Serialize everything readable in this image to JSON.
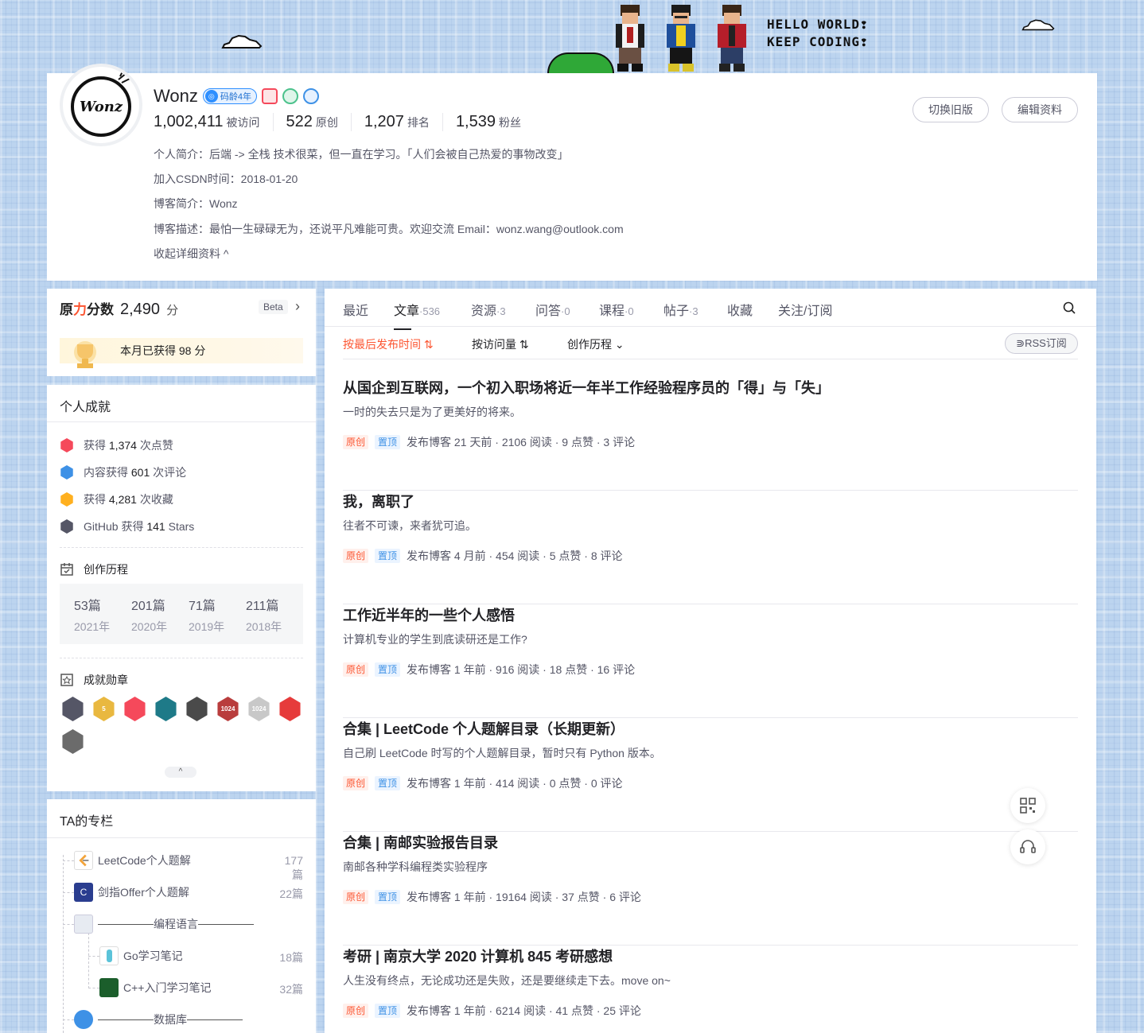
{
  "banner": {
    "hello_line1": "HELLO WORLD❢",
    "hello_line2": "KEEP CODING❢"
  },
  "profile": {
    "avatar_text": "Wonz",
    "username": "Wonz",
    "code_age_badge": "码龄4年",
    "stats": [
      {
        "value": "1,002,411",
        "label": "被访问"
      },
      {
        "value": "522",
        "label": "原创"
      },
      {
        "value": "1,207",
        "label": "排名"
      },
      {
        "value": "1,539",
        "label": "粉丝"
      }
    ],
    "intro": "个人简介：后端 -> 全栈 技术很菜，但一直在学习。「人们会被自己热爱的事物改变」",
    "join_date": "加入CSDN时间：2018-01-20",
    "blog_name": "博客简介：Wonz",
    "blog_desc": "博客描述：最怕一生碌碌无为，还说平凡难能可贵。欢迎交流 Email：wonz.wang@outlook.com",
    "collapse_label": "收起详细资料 ^",
    "switch_old_label": "切换旧版",
    "edit_label": "编辑资料"
  },
  "score": {
    "title_prefix": "原",
    "title_accent": "力",
    "title_suffix": "分数",
    "value": "2,490",
    "unit": "分",
    "beta": "Beta",
    "chevron": "›",
    "month_text": "本月已获得 98 分"
  },
  "achievements": {
    "title": "个人成就",
    "items": [
      {
        "pre": "获得 ",
        "num": "1,374",
        "post": " 次点赞",
        "color": "#f5495b"
      },
      {
        "pre": "内容获得 ",
        "num": "601",
        "post": " 次评论",
        "color": "#3e91e6"
      },
      {
        "pre": "获得 ",
        "num": "4,281",
        "post": " 次收藏",
        "color": "#ffb01f"
      },
      {
        "pre": "GitHub 获得 ",
        "num": "141",
        "post": " Stars",
        "color": "#555666"
      }
    ],
    "history_title": "创作历程",
    "history": [
      {
        "count": "53篇",
        "year": "2021年"
      },
      {
        "count": "201篇",
        "year": "2020年"
      },
      {
        "count": "71篇",
        "year": "2019年"
      },
      {
        "count": "211篇",
        "year": "2018年"
      }
    ],
    "medals_title": "成就勋章",
    "medals": [
      {
        "icon": "github-medal",
        "color": "#555666",
        "text": ""
      },
      {
        "icon": "5-year-medal",
        "color": "#e9b840",
        "text": "5"
      },
      {
        "icon": "red-star-medal",
        "color": "#f5495b",
        "text": ""
      },
      {
        "icon": "list-medal",
        "color": "#1e7a88",
        "text": ""
      },
      {
        "icon": "dark-medal",
        "color": "#4a4a4a",
        "text": ""
      },
      {
        "icon": "1024-medal",
        "color": "#b93d3d",
        "text": "1024"
      },
      {
        "icon": "1024-medal-2",
        "color": "#c8c8c8",
        "text": "1024"
      },
      {
        "icon": "pen-medal",
        "color": "#e63b3b",
        "text": ""
      },
      {
        "icon": "bronze-medal",
        "color": "#6b6b6b",
        "text": ""
      }
    ],
    "collapse_glyph": "^"
  },
  "columns": {
    "title": "TA的专栏",
    "items": [
      {
        "label": "LeetCode个人题解",
        "count": "177篇",
        "color": "#f2a33a"
      },
      {
        "label": "剑指Offer个人题解",
        "count": "22篇",
        "color": "#2a3d8f"
      },
      {
        "label": "编程语言",
        "count": "",
        "color": "#b8c4d6"
      },
      {
        "label": "Go学习笔记",
        "count": "18篇",
        "color": "#5bc3d9"
      },
      {
        "label": "C++入门学习笔记",
        "count": "32篇",
        "color": "#1b5e2b"
      },
      {
        "label": "数据库",
        "count": "",
        "color": "#3e91e6"
      }
    ]
  },
  "tabs": [
    {
      "label": "最近",
      "count": ""
    },
    {
      "label": "文章",
      "count": "·536"
    },
    {
      "label": "资源",
      "count": "·3"
    },
    {
      "label": "问答",
      "count": "·0"
    },
    {
      "label": "课程",
      "count": "·0"
    },
    {
      "label": "帖子",
      "count": "·3"
    },
    {
      "label": "收藏",
      "count": ""
    },
    {
      "label": "关注/订阅",
      "count": ""
    }
  ],
  "sorts": {
    "by_time": "按最后发布时间 ⇅",
    "by_views": "按访问量 ⇅",
    "history": "创作历程 ⌄",
    "rss": "RSS订阅"
  },
  "articles": [
    {
      "title": "从国企到互联网，一个初入职场将近一年半工作经验程序员的「得」与「失」",
      "desc": "一时的失去只是为了更美好的将来。",
      "tag1": "原创",
      "tag2": "置顶",
      "meta": "发布博客 21 天前 · 2106 阅读 · 9 点赞 · 3 评论"
    },
    {
      "title": "我，离职了",
      "desc": "往者不可谏，来者犹可追。",
      "tag1": "原创",
      "tag2": "置顶",
      "meta": "发布博客 4 月前 · 454 阅读 · 5 点赞 · 8 评论"
    },
    {
      "title": "工作近半年的一些个人感悟",
      "desc": "计算机专业的学生到底读研还是工作?",
      "tag1": "原创",
      "tag2": "置顶",
      "meta": "发布博客 1 年前 · 916 阅读 · 18 点赞 · 16 评论"
    },
    {
      "title": "合集 | LeetCode 个人题解目录（长期更新）",
      "desc": "自己刷 LeetCode 时写的个人题解目录，暂时只有 Python 版本。",
      "tag1": "原创",
      "tag2": "置顶",
      "meta": "发布博客 1 年前 · 414 阅读 · 0 点赞 · 0 评论"
    },
    {
      "title": "合集 | 南邮实验报告目录",
      "desc": "南邮各种学科编程类实验程序",
      "tag1": "原创",
      "tag2": "置顶",
      "meta": "发布博客 1 年前 · 19164 阅读 · 37 点赞 · 6 评论"
    },
    {
      "title": "考研 | 南京大学 2020 计算机 845 考研感想",
      "desc": "人生没有终点，无论成功还是失败，还是要继续走下去。move on~",
      "tag1": "原创",
      "tag2": "置顶",
      "meta": "发布博客 1 年前 · 6214 阅读 · 41 点赞 · 25 评论"
    }
  ]
}
